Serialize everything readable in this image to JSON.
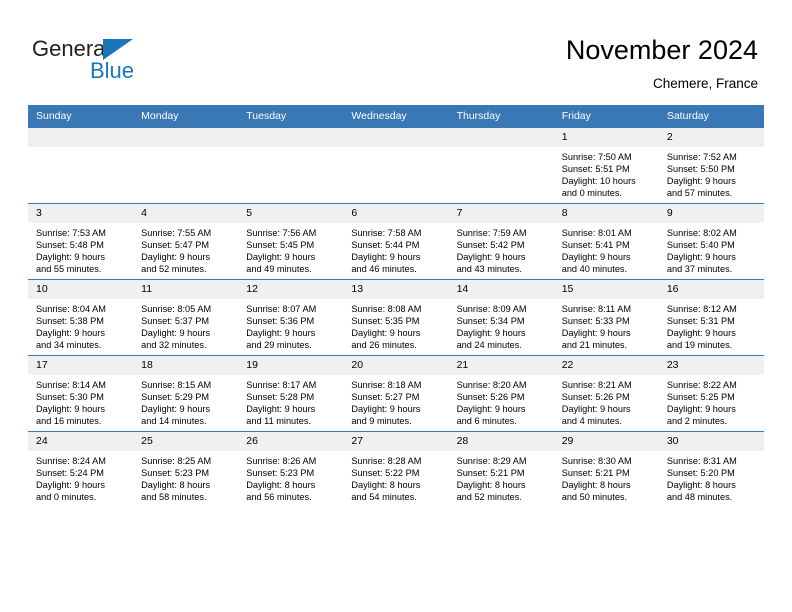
{
  "brand": {
    "name_part1": "General",
    "name_part2": "Blue"
  },
  "header": {
    "title": "November 2024",
    "subtitle": "Chemere, France"
  },
  "colors": {
    "header_blue": "#3a78b5",
    "brand_blue": "#1b75bb",
    "daynum_bg": "#f0f0f0"
  },
  "calendar": {
    "weekday_headers": [
      "Sunday",
      "Monday",
      "Tuesday",
      "Wednesday",
      "Thursday",
      "Friday",
      "Saturday"
    ],
    "labels": {
      "sunrise": "Sunrise:",
      "sunset": "Sunset:",
      "daylight": "Daylight:"
    },
    "weeks": [
      [
        {
          "day": "",
          "blank": true,
          "line1": "",
          "line2": "",
          "line3": "",
          "line4": ""
        },
        {
          "day": "",
          "blank": true,
          "line1": "",
          "line2": "",
          "line3": "",
          "line4": ""
        },
        {
          "day": "",
          "blank": true,
          "line1": "",
          "line2": "",
          "line3": "",
          "line4": ""
        },
        {
          "day": "",
          "blank": true,
          "line1": "",
          "line2": "",
          "line3": "",
          "line4": ""
        },
        {
          "day": "",
          "blank": true,
          "line1": "",
          "line2": "",
          "line3": "",
          "line4": ""
        },
        {
          "day": "1",
          "blank": false,
          "line1": "Sunrise: 7:50 AM",
          "line2": "Sunset: 5:51 PM",
          "line3": "Daylight: 10 hours",
          "line4": "and 0 minutes."
        },
        {
          "day": "2",
          "blank": false,
          "line1": "Sunrise: 7:52 AM",
          "line2": "Sunset: 5:50 PM",
          "line3": "Daylight: 9 hours",
          "line4": "and 57 minutes."
        }
      ],
      [
        {
          "day": "3",
          "blank": false,
          "line1": "Sunrise: 7:53 AM",
          "line2": "Sunset: 5:48 PM",
          "line3": "Daylight: 9 hours",
          "line4": "and 55 minutes."
        },
        {
          "day": "4",
          "blank": false,
          "line1": "Sunrise: 7:55 AM",
          "line2": "Sunset: 5:47 PM",
          "line3": "Daylight: 9 hours",
          "line4": "and 52 minutes."
        },
        {
          "day": "5",
          "blank": false,
          "line1": "Sunrise: 7:56 AM",
          "line2": "Sunset: 5:45 PM",
          "line3": "Daylight: 9 hours",
          "line4": "and 49 minutes."
        },
        {
          "day": "6",
          "blank": false,
          "line1": "Sunrise: 7:58 AM",
          "line2": "Sunset: 5:44 PM",
          "line3": "Daylight: 9 hours",
          "line4": "and 46 minutes."
        },
        {
          "day": "7",
          "blank": false,
          "line1": "Sunrise: 7:59 AM",
          "line2": "Sunset: 5:42 PM",
          "line3": "Daylight: 9 hours",
          "line4": "and 43 minutes."
        },
        {
          "day": "8",
          "blank": false,
          "line1": "Sunrise: 8:01 AM",
          "line2": "Sunset: 5:41 PM",
          "line3": "Daylight: 9 hours",
          "line4": "and 40 minutes."
        },
        {
          "day": "9",
          "blank": false,
          "line1": "Sunrise: 8:02 AM",
          "line2": "Sunset: 5:40 PM",
          "line3": "Daylight: 9 hours",
          "line4": "and 37 minutes."
        }
      ],
      [
        {
          "day": "10",
          "blank": false,
          "line1": "Sunrise: 8:04 AM",
          "line2": "Sunset: 5:38 PM",
          "line3": "Daylight: 9 hours",
          "line4": "and 34 minutes."
        },
        {
          "day": "11",
          "blank": false,
          "line1": "Sunrise: 8:05 AM",
          "line2": "Sunset: 5:37 PM",
          "line3": "Daylight: 9 hours",
          "line4": "and 32 minutes."
        },
        {
          "day": "12",
          "blank": false,
          "line1": "Sunrise: 8:07 AM",
          "line2": "Sunset: 5:36 PM",
          "line3": "Daylight: 9 hours",
          "line4": "and 29 minutes."
        },
        {
          "day": "13",
          "blank": false,
          "line1": "Sunrise: 8:08 AM",
          "line2": "Sunset: 5:35 PM",
          "line3": "Daylight: 9 hours",
          "line4": "and 26 minutes."
        },
        {
          "day": "14",
          "blank": false,
          "line1": "Sunrise: 8:09 AM",
          "line2": "Sunset: 5:34 PM",
          "line3": "Daylight: 9 hours",
          "line4": "and 24 minutes."
        },
        {
          "day": "15",
          "blank": false,
          "line1": "Sunrise: 8:11 AM",
          "line2": "Sunset: 5:33 PM",
          "line3": "Daylight: 9 hours",
          "line4": "and 21 minutes."
        },
        {
          "day": "16",
          "blank": false,
          "line1": "Sunrise: 8:12 AM",
          "line2": "Sunset: 5:31 PM",
          "line3": "Daylight: 9 hours",
          "line4": "and 19 minutes."
        }
      ],
      [
        {
          "day": "17",
          "blank": false,
          "line1": "Sunrise: 8:14 AM",
          "line2": "Sunset: 5:30 PM",
          "line3": "Daylight: 9 hours",
          "line4": "and 16 minutes."
        },
        {
          "day": "18",
          "blank": false,
          "line1": "Sunrise: 8:15 AM",
          "line2": "Sunset: 5:29 PM",
          "line3": "Daylight: 9 hours",
          "line4": "and 14 minutes."
        },
        {
          "day": "19",
          "blank": false,
          "line1": "Sunrise: 8:17 AM",
          "line2": "Sunset: 5:28 PM",
          "line3": "Daylight: 9 hours",
          "line4": "and 11 minutes."
        },
        {
          "day": "20",
          "blank": false,
          "line1": "Sunrise: 8:18 AM",
          "line2": "Sunset: 5:27 PM",
          "line3": "Daylight: 9 hours",
          "line4": "and 9 minutes."
        },
        {
          "day": "21",
          "blank": false,
          "line1": "Sunrise: 8:20 AM",
          "line2": "Sunset: 5:26 PM",
          "line3": "Daylight: 9 hours",
          "line4": "and 6 minutes."
        },
        {
          "day": "22",
          "blank": false,
          "line1": "Sunrise: 8:21 AM",
          "line2": "Sunset: 5:26 PM",
          "line3": "Daylight: 9 hours",
          "line4": "and 4 minutes."
        },
        {
          "day": "23",
          "blank": false,
          "line1": "Sunrise: 8:22 AM",
          "line2": "Sunset: 5:25 PM",
          "line3": "Daylight: 9 hours",
          "line4": "and 2 minutes."
        }
      ],
      [
        {
          "day": "24",
          "blank": false,
          "line1": "Sunrise: 8:24 AM",
          "line2": "Sunset: 5:24 PM",
          "line3": "Daylight: 9 hours",
          "line4": "and 0 minutes."
        },
        {
          "day": "25",
          "blank": false,
          "line1": "Sunrise: 8:25 AM",
          "line2": "Sunset: 5:23 PM",
          "line3": "Daylight: 8 hours",
          "line4": "and 58 minutes."
        },
        {
          "day": "26",
          "blank": false,
          "line1": "Sunrise: 8:26 AM",
          "line2": "Sunset: 5:23 PM",
          "line3": "Daylight: 8 hours",
          "line4": "and 56 minutes."
        },
        {
          "day": "27",
          "blank": false,
          "line1": "Sunrise: 8:28 AM",
          "line2": "Sunset: 5:22 PM",
          "line3": "Daylight: 8 hours",
          "line4": "and 54 minutes."
        },
        {
          "day": "28",
          "blank": false,
          "line1": "Sunrise: 8:29 AM",
          "line2": "Sunset: 5:21 PM",
          "line3": "Daylight: 8 hours",
          "line4": "and 52 minutes."
        },
        {
          "day": "29",
          "blank": false,
          "line1": "Sunrise: 8:30 AM",
          "line2": "Sunset: 5:21 PM",
          "line3": "Daylight: 8 hours",
          "line4": "and 50 minutes."
        },
        {
          "day": "30",
          "blank": false,
          "line1": "Sunrise: 8:31 AM",
          "line2": "Sunset: 5:20 PM",
          "line3": "Daylight: 8 hours",
          "line4": "and 48 minutes."
        }
      ]
    ]
  }
}
